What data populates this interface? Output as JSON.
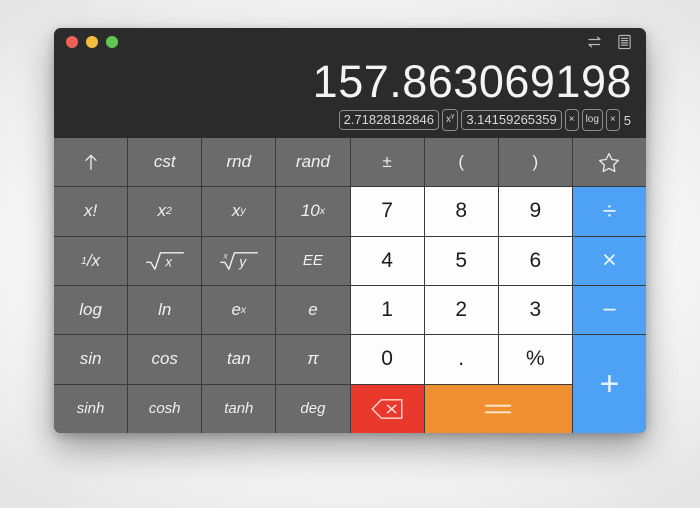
{
  "window": {
    "traffic_lights": [
      "close",
      "minimize",
      "maximize"
    ],
    "actions": [
      {
        "name": "swap-icon",
        "label": "⇌"
      },
      {
        "name": "history-icon",
        "label": "☰"
      }
    ]
  },
  "display": {
    "value": "157.863069198",
    "formula_tokens": [
      {
        "text": "2.71828182846",
        "style": "boxed"
      },
      {
        "text": "xʸ",
        "style": "boxed-small"
      },
      {
        "text": "3.14159265359",
        "style": "boxed"
      },
      {
        "text": "×",
        "style": "boxed-small"
      },
      {
        "text": "log",
        "style": "boxed-small"
      },
      {
        "text": "×",
        "style": "boxed-small"
      },
      {
        "text": "5",
        "style": "plain"
      }
    ]
  },
  "keypad": {
    "row1": [
      {
        "label": "↑",
        "name": "key-up-arrow",
        "type": "fn"
      },
      {
        "label": "cst",
        "name": "key-cst",
        "type": "fn"
      },
      {
        "label": "rnd",
        "name": "key-rnd",
        "type": "fn"
      },
      {
        "label": "rand",
        "name": "key-rand",
        "type": "fn"
      },
      {
        "label": "±",
        "name": "key-plus-minus",
        "type": "fn"
      },
      {
        "label": "(",
        "name": "key-open-paren",
        "type": "fn"
      },
      {
        "label": ")",
        "name": "key-close-paren",
        "type": "fn"
      },
      {
        "label": "☆",
        "name": "key-favorite-star",
        "type": "fn"
      }
    ],
    "row2": [
      {
        "label": "x!",
        "name": "key-factorial",
        "type": "fn"
      },
      {
        "label": "x2",
        "name": "key-x-squared",
        "type": "fn"
      },
      {
        "label": "xy",
        "name": "key-x-power-y",
        "type": "fn"
      },
      {
        "label": "10x",
        "name": "key-ten-power-x",
        "type": "fn"
      },
      {
        "label": "7",
        "name": "key-7",
        "type": "num"
      },
      {
        "label": "8",
        "name": "key-8",
        "type": "num"
      },
      {
        "label": "9",
        "name": "key-9",
        "type": "num"
      },
      {
        "label": "÷",
        "name": "key-divide",
        "type": "op"
      }
    ],
    "row3": [
      {
        "label": "1/x",
        "name": "key-reciprocal",
        "type": "fn"
      },
      {
        "label": "√x",
        "name": "key-square-root",
        "type": "fn"
      },
      {
        "label": "x√y",
        "name": "key-nth-root",
        "type": "fn"
      },
      {
        "label": "EE",
        "name": "key-ee",
        "type": "fn"
      },
      {
        "label": "4",
        "name": "key-4",
        "type": "num"
      },
      {
        "label": "5",
        "name": "key-5",
        "type": "num"
      },
      {
        "label": "6",
        "name": "key-6",
        "type": "num"
      },
      {
        "label": "×",
        "name": "key-multiply",
        "type": "op"
      }
    ],
    "row4": [
      {
        "label": "log",
        "name": "key-log",
        "type": "fn"
      },
      {
        "label": "ln",
        "name": "key-ln",
        "type": "fn"
      },
      {
        "label": "ex",
        "name": "key-e-power-x",
        "type": "fn"
      },
      {
        "label": "e",
        "name": "key-e",
        "type": "fn"
      },
      {
        "label": "1",
        "name": "key-1",
        "type": "num"
      },
      {
        "label": "2",
        "name": "key-2",
        "type": "num"
      },
      {
        "label": "3",
        "name": "key-3",
        "type": "num"
      },
      {
        "label": "−",
        "name": "key-subtract",
        "type": "op"
      }
    ],
    "row5": [
      {
        "label": "sin",
        "name": "key-sin",
        "type": "fn"
      },
      {
        "label": "cos",
        "name": "key-cos",
        "type": "fn"
      },
      {
        "label": "tan",
        "name": "key-tan",
        "type": "fn"
      },
      {
        "label": "π",
        "name": "key-pi",
        "type": "fn"
      },
      {
        "label": "0",
        "name": "key-0",
        "type": "num"
      },
      {
        "label": ".",
        "name": "key-decimal-point",
        "type": "num"
      },
      {
        "label": "%",
        "name": "key-percent",
        "type": "num"
      },
      {
        "label": "+",
        "name": "key-add",
        "type": "op"
      }
    ],
    "row6": [
      {
        "label": "sinh",
        "name": "key-sinh",
        "type": "fn"
      },
      {
        "label": "cosh",
        "name": "key-cosh",
        "type": "fn"
      },
      {
        "label": "tanh",
        "name": "key-tanh",
        "type": "fn"
      },
      {
        "label": "deg",
        "name": "key-deg",
        "type": "fn"
      },
      {
        "label": "⌫",
        "name": "key-backspace",
        "type": "del"
      },
      {
        "label": "=",
        "name": "key-equals",
        "type": "eq"
      }
    ]
  },
  "colors": {
    "window_bg": "#2b2b2b",
    "function_key": "#6b6b6b",
    "number_key": "#fdfdfd",
    "operator_key": "#4da2f5",
    "delete_key": "#e8392c",
    "equals_key": "#ef8f30"
  }
}
